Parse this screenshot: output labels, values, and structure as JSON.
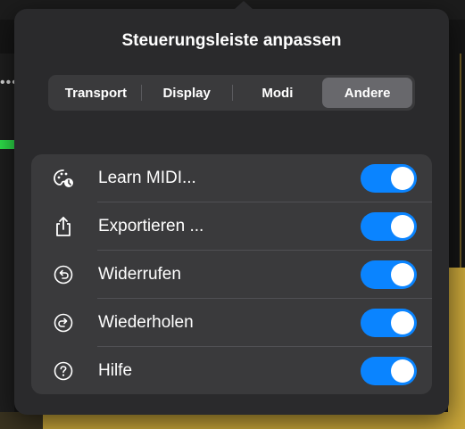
{
  "popover": {
    "title": "Steuerungsleiste anpassen"
  },
  "tabs": [
    {
      "label": "Transport",
      "selected": false
    },
    {
      "label": "Display",
      "selected": false
    },
    {
      "label": "Modi",
      "selected": false
    },
    {
      "label": "Andere",
      "selected": true
    }
  ],
  "items": [
    {
      "label": "Learn MIDI...",
      "icon": "learn-midi-icon",
      "enabled": true
    },
    {
      "label": "Exportieren ...",
      "icon": "export-icon",
      "enabled": true
    },
    {
      "label": "Widerrufen",
      "icon": "undo-icon",
      "enabled": true
    },
    {
      "label": "Wiederholen",
      "icon": "redo-icon",
      "enabled": true
    },
    {
      "label": "Hilfe",
      "icon": "help-icon",
      "enabled": true
    }
  ],
  "colors": {
    "toggle_on": "#0a84ff",
    "popover_bg": "#2a2a2c"
  }
}
